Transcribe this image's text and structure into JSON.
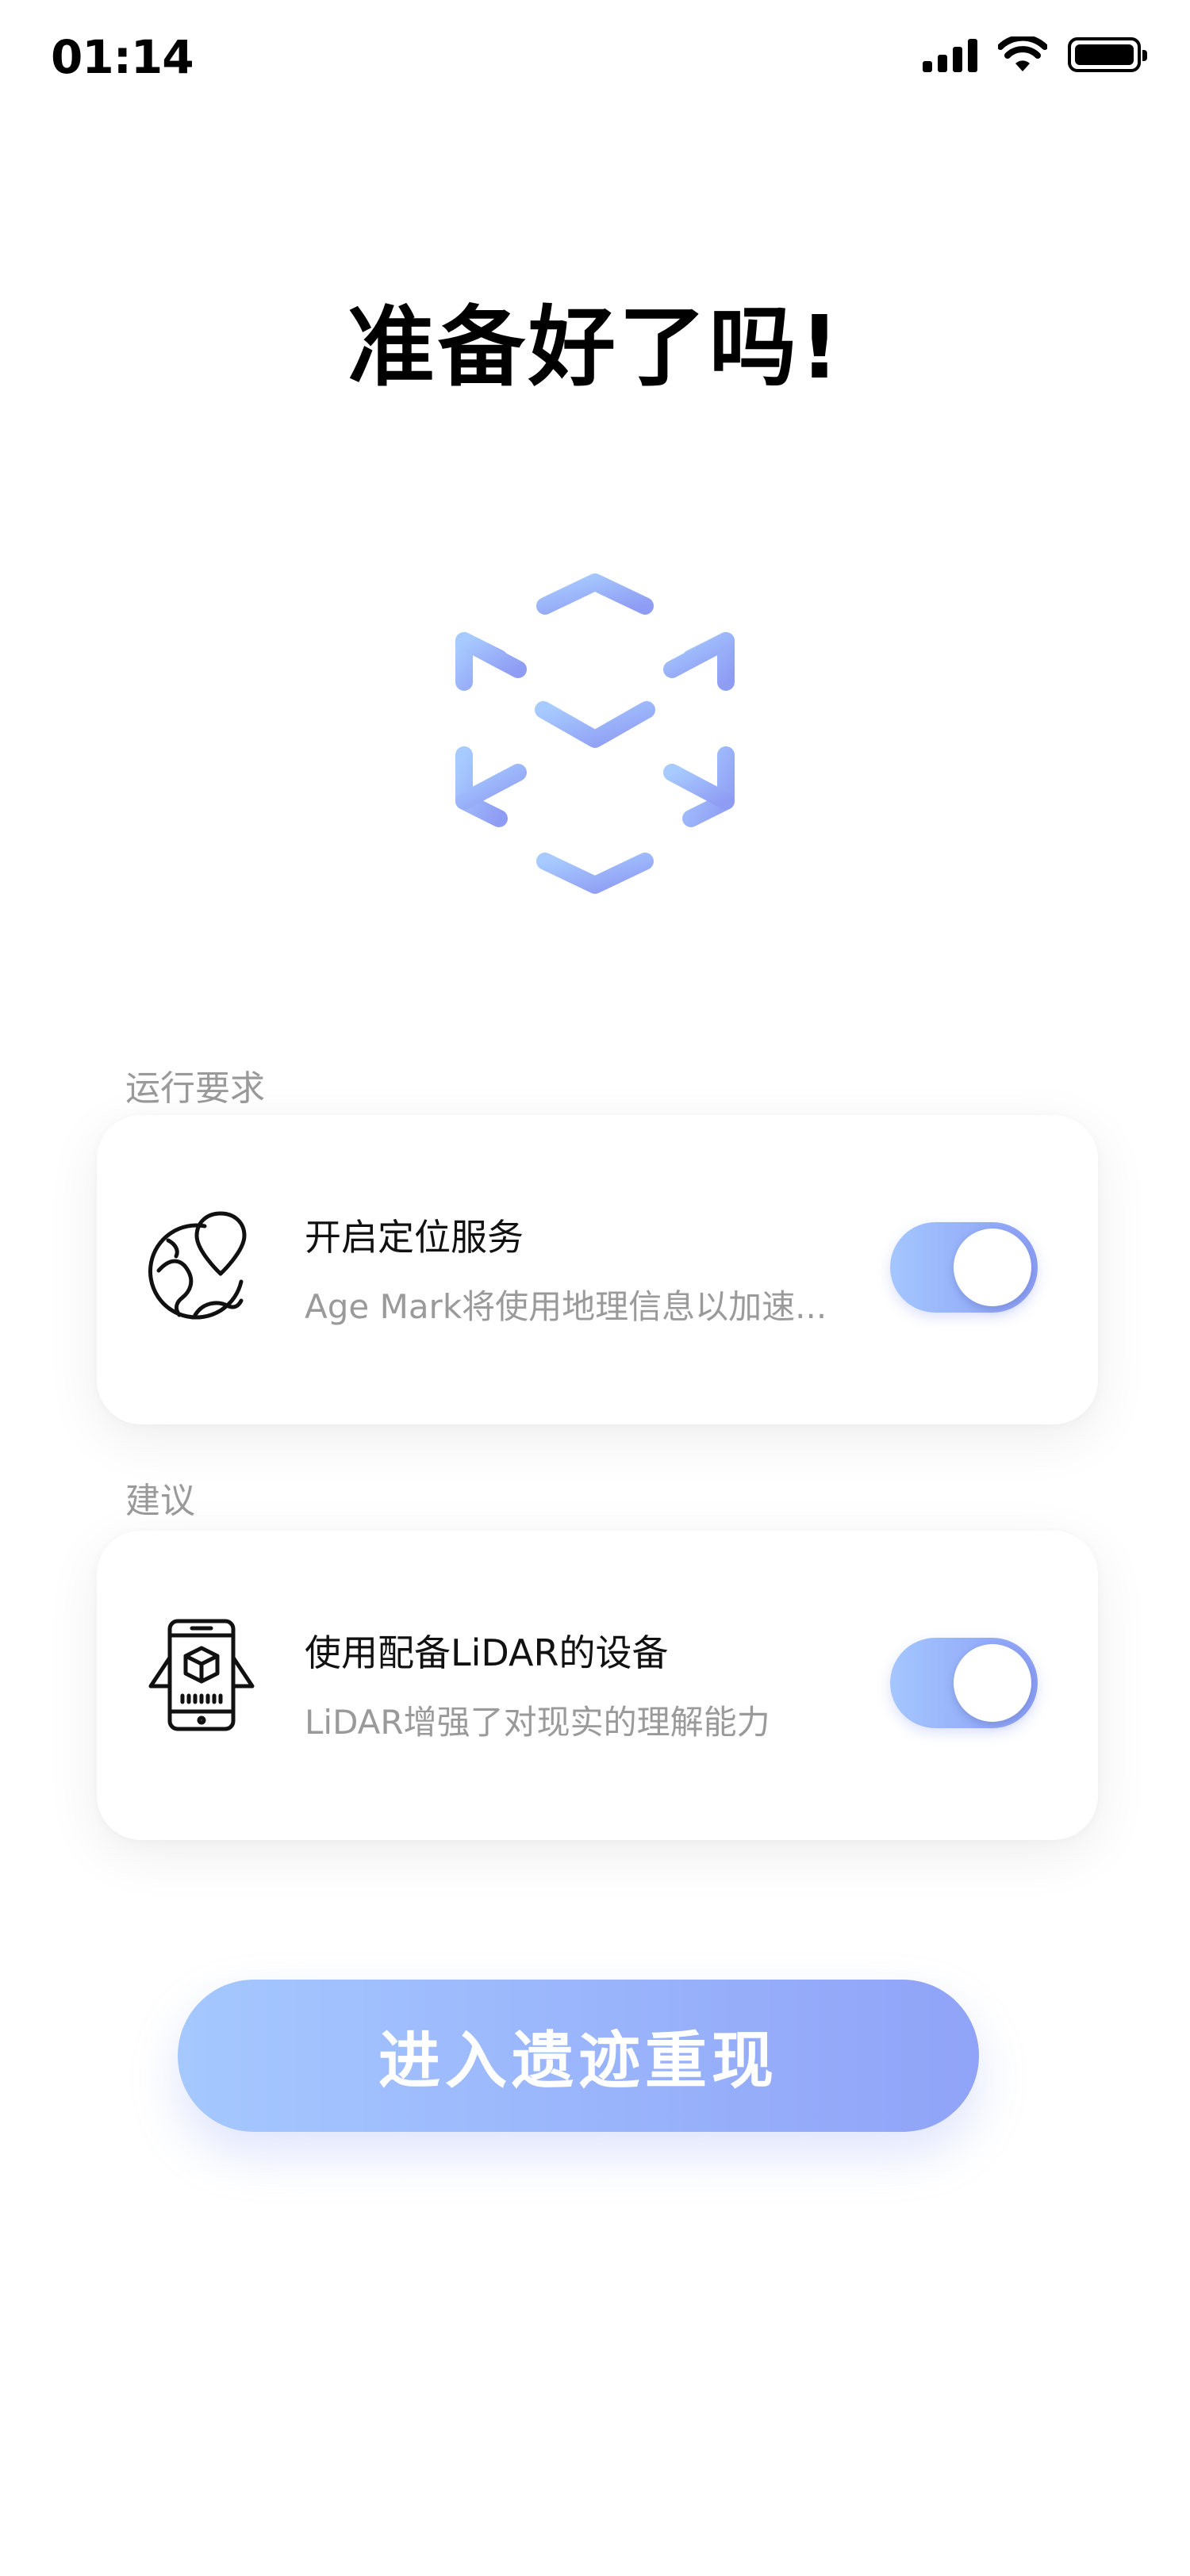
{
  "status_bar": {
    "time": "01:14",
    "icons": [
      "cellular-signal-icon",
      "wifi-icon",
      "battery-icon"
    ]
  },
  "title": "准备好了吗!",
  "hero_icon": "ar-cube-icon",
  "sections": [
    {
      "label": "运行要求",
      "item": {
        "icon": "globe-location-icon",
        "title": "开启定位服务",
        "subtitle": "Age Mark将使用地理信息以加速...",
        "toggle_on": true
      }
    },
    {
      "label": "建议",
      "item": {
        "icon": "phone-lidar-icon",
        "title": "使用配备LiDAR的设备",
        "subtitle": "LiDAR增强了对现实的理解能力",
        "toggle_on": true
      }
    }
  ],
  "primary_button": {
    "label": "进入遗迹重现"
  },
  "colors": {
    "accent_start": "#a5c8ff",
    "accent_end": "#8b9ef5",
    "muted_text": "#9a9a9a"
  }
}
